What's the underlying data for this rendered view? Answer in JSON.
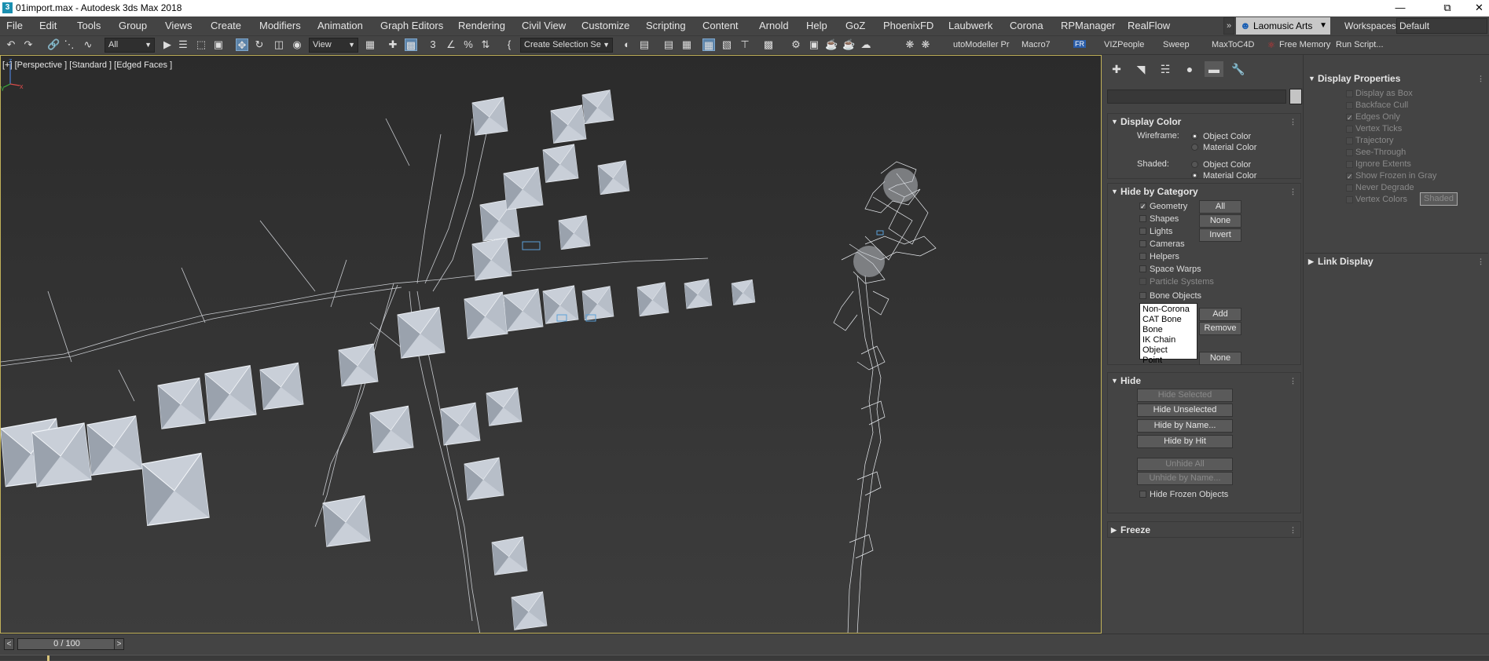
{
  "window": {
    "title": "01import.max - Autodesk 3ds Max 2018",
    "app_icon": "3"
  },
  "menu": {
    "items": [
      "File",
      "Edit",
      "Tools",
      "Group",
      "Views",
      "Create",
      "Modifiers",
      "Animation",
      "Graph Editors",
      "Rendering",
      "Civil View",
      "Customize",
      "Scripting",
      "Content",
      "Arnold",
      "Help",
      "GoZ",
      "PhoenixFD",
      "Laubwerk",
      "Corona",
      "RPManager",
      "RealFlow"
    ],
    "overflow": "»",
    "user": "Laomusic Arts",
    "workspaces_label": "Workspaces:",
    "workspace_value": "Default"
  },
  "toolbar": {
    "selection_filter": "All",
    "ref_coord": "View",
    "selection_set": "Create Selection Se",
    "scripts": [
      "utoModeller Pr",
      "Macro7",
      "VIZPeople",
      "Sweep",
      "MaxToC4D",
      "Free Memory",
      "Run Script..."
    ],
    "fr_badge": "FR"
  },
  "viewport": {
    "label": "[+] [Perspective ] [Standard ] [Edged Faces ]",
    "axis_x": "x",
    "axis_y": "y",
    "axis_z": "z"
  },
  "display_color": {
    "title": "Display Color",
    "wireframe_label": "Wireframe:",
    "shaded_label": "Shaded:",
    "object_color": "Object Color",
    "material_color": "Material Color"
  },
  "hide_by_category": {
    "title": "Hide by Category",
    "items": [
      {
        "label": "Geometry",
        "checked": true,
        "enabled": true
      },
      {
        "label": "Shapes",
        "checked": false,
        "enabled": true
      },
      {
        "label": "Lights",
        "checked": false,
        "enabled": true
      },
      {
        "label": "Cameras",
        "checked": false,
        "enabled": true
      },
      {
        "label": "Helpers",
        "checked": false,
        "enabled": true
      },
      {
        "label": "Space Warps",
        "checked": false,
        "enabled": true
      },
      {
        "label": "Particle Systems",
        "checked": false,
        "enabled": false
      },
      {
        "label": "Bone Objects",
        "checked": false,
        "enabled": true
      }
    ],
    "btn_all": "All",
    "btn_none": "None",
    "btn_invert": "Invert",
    "list": [
      "Non-Corona",
      "CAT Bone",
      "Bone",
      "IK Chain Object",
      "Point"
    ],
    "btn_add": "Add",
    "btn_remove": "Remove",
    "btn_none2": "None"
  },
  "hide": {
    "title": "Hide",
    "hide_selected": "Hide Selected",
    "hide_unselected": "Hide Unselected",
    "hide_by_name": "Hide by Name...",
    "hide_by_hit": "Hide by Hit",
    "unhide_all": "Unhide All",
    "unhide_by_name": "Unhide by Name...",
    "hide_frozen": "Hide Frozen Objects"
  },
  "freeze": {
    "title": "Freeze"
  },
  "display_properties": {
    "title": "Display Properties",
    "items": [
      {
        "label": "Display as Box",
        "checked": false
      },
      {
        "label": "Backface Cull",
        "checked": false
      },
      {
        "label": "Edges Only",
        "checked": true
      },
      {
        "label": "Vertex Ticks",
        "checked": false
      },
      {
        "label": "Trajectory",
        "checked": false
      },
      {
        "label": "See-Through",
        "checked": false
      },
      {
        "label": "Ignore Extents",
        "checked": false
      },
      {
        "label": "Show Frozen in Gray",
        "checked": true
      },
      {
        "label": "Never Degrade",
        "checked": false
      },
      {
        "label": "Vertex Colors",
        "checked": false
      }
    ],
    "shaded_btn": "Shaded"
  },
  "link_display": {
    "title": "Link Display"
  },
  "timeslider": {
    "frame": "0 / 100",
    "prev": "<",
    "next": ">"
  },
  "colors": {
    "accent": "#5b82a8",
    "viewport_border": "#c1b15a",
    "panel_bg": "#444444"
  }
}
